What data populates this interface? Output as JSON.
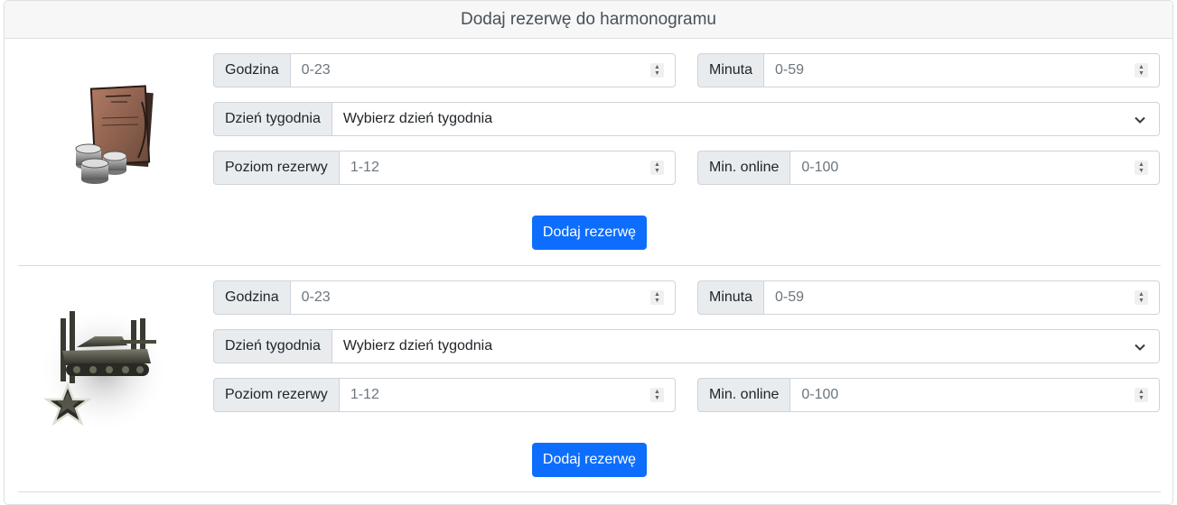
{
  "header": {
    "title": "Dodaj rezerwę do harmonogramu"
  },
  "reserves": [
    {
      "image_icon": "credit-reserve-icon",
      "hour": {
        "label": "Godzina",
        "placeholder": "0-23"
      },
      "minute": {
        "label": "Minuta",
        "placeholder": "0-59"
      },
      "day": {
        "label": "Dzień tygodnia",
        "selected": "Wybierz dzień tygodnia"
      },
      "level": {
        "label": "Poziom rezerwy",
        "placeholder": "1-12"
      },
      "min_online": {
        "label": "Min. online",
        "placeholder": "0-100"
      },
      "button": "Dodaj rezerwę"
    },
    {
      "image_icon": "tank-training-reserve-icon",
      "hour": {
        "label": "Godzina",
        "placeholder": "0-23"
      },
      "minute": {
        "label": "Minuta",
        "placeholder": "0-59"
      },
      "day": {
        "label": "Dzień tygodnia",
        "selected": "Wybierz dzień tygodnia"
      },
      "level": {
        "label": "Poziom rezerwy",
        "placeholder": "1-12"
      },
      "min_online": {
        "label": "Min. online",
        "placeholder": "0-100"
      },
      "button": "Dodaj rezerwę"
    }
  ]
}
